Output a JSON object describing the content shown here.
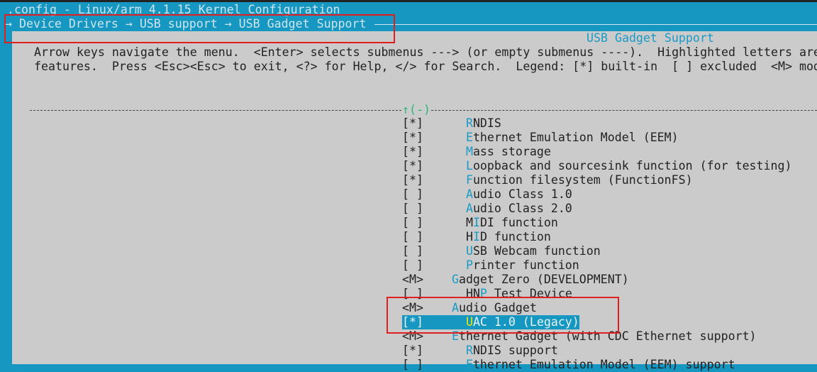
{
  "window": {
    "title": ".config - Linux/arm 4.1.15 Kernel Configuration"
  },
  "breadcrumb": "→ Device Drivers → USB support → USB Gadget Support",
  "panel_title": "USB Gadget Support",
  "help": [
    "Arrow keys navigate the menu.  <Enter> selects submenus ---> (or empty submenus ----).  Highlighted letters are",
    "features.  Press <Esc><Esc> to exit, <?> for Help, </> for Search.  Legend: [*] built-in  [ ] excluded  <M> mod"
  ],
  "scroll_indicator": "↑(-)",
  "colors": {
    "blue": "#1597c2",
    "gray": "#cbcbcb",
    "hotkey": "#1a9ac4",
    "highlight_hotkey": "#e8e800"
  },
  "items": [
    {
      "state": "[*]",
      "indent": "      ",
      "hotkey": "R",
      "rest": "NDIS"
    },
    {
      "state": "[*]",
      "indent": "      ",
      "hotkey": "E",
      "rest": "thernet Emulation Model (EEM)"
    },
    {
      "state": "[*]",
      "indent": "      ",
      "hotkey": "M",
      "rest": "ass storage"
    },
    {
      "state": "[*]",
      "indent": "      ",
      "hotkey": "L",
      "rest": "oopback and sourcesink function (for testing)"
    },
    {
      "state": "[*]",
      "indent": "      ",
      "hotkey": "F",
      "rest": "unction filesystem (FunctionFS)"
    },
    {
      "state": "[ ]",
      "indent": "      ",
      "hotkey": "A",
      "rest": "udio Class 1.0"
    },
    {
      "state": "[ ]",
      "indent": "      ",
      "hotkey": "A",
      "rest": "udio Class 2.0"
    },
    {
      "state": "[ ]",
      "indent": "      ",
      "pre": "M",
      "hotkey": "I",
      "rest": "DI function"
    },
    {
      "state": "[ ]",
      "indent": "      ",
      "pre": "H",
      "hotkey": "I",
      "rest": "D function"
    },
    {
      "state": "[ ]",
      "indent": "      ",
      "hotkey": "U",
      "rest": "SB Webcam function"
    },
    {
      "state": "[ ]",
      "indent": "      ",
      "hotkey": "P",
      "rest": "rinter function"
    },
    {
      "state": "<M>",
      "indent": "    ",
      "hotkey": "G",
      "rest": "adget Zero (DEVELOPMENT)"
    },
    {
      "state": "[ ]",
      "indent": "      ",
      "pre": "HN",
      "hotkey": "P",
      "rest": " Test Device"
    },
    {
      "state": "<M>",
      "indent": "    ",
      "hotkey": "A",
      "rest": "udio Gadget"
    },
    {
      "state": "[*]",
      "indent": "      ",
      "hotkey": "U",
      "rest": "AC 1.0 (Legacy)",
      "selected": true
    },
    {
      "state": "<M>",
      "indent": "    ",
      "hotkey": "E",
      "rest": "thernet Gadget (with CDC Ethernet support)"
    },
    {
      "state": "[*]",
      "indent": "      ",
      "hotkey": "R",
      "rest": "NDIS support"
    },
    {
      "state": "[ ]",
      "indent": "      ",
      "hotkey": "E",
      "rest": "thernet Emulation Model (EEM) support"
    }
  ]
}
